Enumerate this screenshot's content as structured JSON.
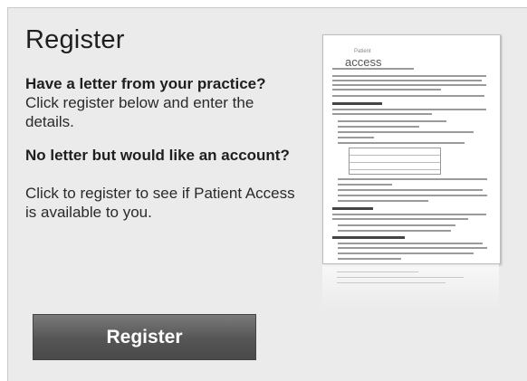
{
  "register": {
    "title": "Register",
    "q1_title": "Have a letter from your practice?",
    "q1_text": "Click register below and enter the details.",
    "q2_title": "No letter but would like an account?",
    "q2_text": "Click to register to see if Patient Access is available to you.",
    "button_label": "Register"
  },
  "letter": {
    "logo_brand": "access",
    "logo_small": "Patient"
  }
}
